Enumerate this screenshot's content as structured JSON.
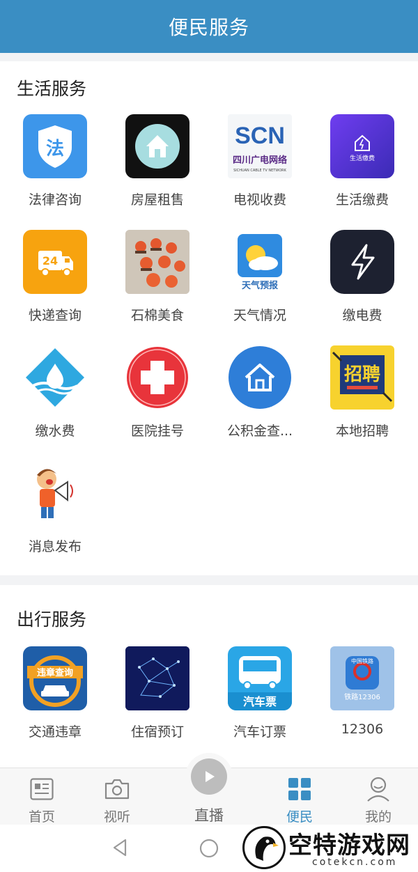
{
  "header": {
    "title": "便民服务"
  },
  "life_services": {
    "title": "生活服务",
    "items": [
      {
        "label": "法律咨询",
        "icon": "law-badge-icon",
        "badge_text": "法"
      },
      {
        "label": "房屋租售",
        "icon": "house-icon"
      },
      {
        "label": "电视收费",
        "icon": "scn-tv-logo",
        "logo_text": "SCN",
        "logo_sub": "四川广电网络",
        "logo_en": "SICHUAN CABLE TV NETWORK"
      },
      {
        "label": "生活缴费",
        "icon": "life-pay-icon",
        "inner_text": "生活缴费"
      },
      {
        "label": "快递查询",
        "icon": "delivery-truck-icon",
        "badge_text": "24"
      },
      {
        "label": "石棉美食",
        "icon": "food-photo"
      },
      {
        "label": "天气情况",
        "icon": "weather-icon",
        "inner_text": "天气预报"
      },
      {
        "label": "缴电费",
        "icon": "lightning-icon"
      },
      {
        "label": "缴水费",
        "icon": "water-drop-icon"
      },
      {
        "label": "医院挂号",
        "icon": "hospital-cross-icon"
      },
      {
        "label": "公积金查...",
        "icon": "home-fund-icon"
      },
      {
        "label": "本地招聘",
        "icon": "recruit-icon",
        "inner_text": "招聘"
      },
      {
        "label": "消息发布",
        "icon": "megaphone-boy-icon"
      }
    ]
  },
  "travel_services": {
    "title": "出行服务",
    "items": [
      {
        "label": "交通违章",
        "icon": "traffic-violation-icon",
        "inner_text": "违章查询"
      },
      {
        "label": "住宿预订",
        "icon": "lodging-network-icon"
      },
      {
        "label": "汽车订票",
        "icon": "bus-icon",
        "inner_text": "汽车票"
      },
      {
        "label": "12306",
        "icon": "railway-icon",
        "inner_text": "中国铁路",
        "inner_sub": "铁路12306"
      }
    ]
  },
  "tabbar": {
    "tabs": [
      {
        "label": "首页",
        "icon": "news-icon"
      },
      {
        "label": "视听",
        "icon": "camera-icon"
      },
      {
        "label": "直播",
        "icon": "play-icon"
      },
      {
        "label": "便民",
        "icon": "grid-icon"
      },
      {
        "label": "我的",
        "icon": "user-icon"
      }
    ],
    "active_index": 3
  },
  "watermark": {
    "title": "空特游戏网",
    "sub": "cotekcn.com"
  },
  "colors": {
    "header": "#3a8ec3",
    "accent": "#3a8ec3",
    "background": "#f2f3f5"
  }
}
